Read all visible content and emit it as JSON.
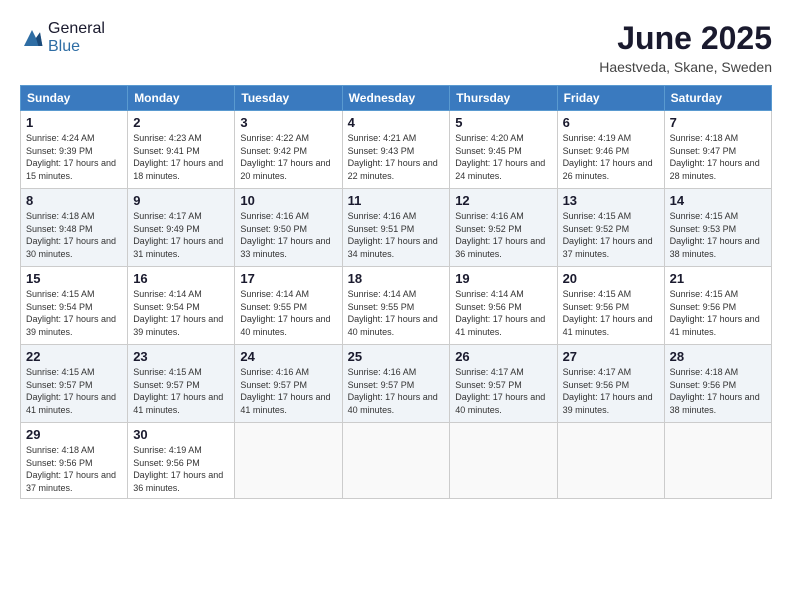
{
  "header": {
    "logo": {
      "line1": "General",
      "line2": "Blue"
    },
    "title": "June 2025",
    "subtitle": "Haestveda, Skane, Sweden"
  },
  "days_of_week": [
    "Sunday",
    "Monday",
    "Tuesday",
    "Wednesday",
    "Thursday",
    "Friday",
    "Saturday"
  ],
  "weeks": [
    [
      {
        "day": "1",
        "rise": "Sunrise: 4:24 AM",
        "set": "Sunset: 9:39 PM",
        "daylight": "Daylight: 17 hours and 15 minutes."
      },
      {
        "day": "2",
        "rise": "Sunrise: 4:23 AM",
        "set": "Sunset: 9:41 PM",
        "daylight": "Daylight: 17 hours and 18 minutes."
      },
      {
        "day": "3",
        "rise": "Sunrise: 4:22 AM",
        "set": "Sunset: 9:42 PM",
        "daylight": "Daylight: 17 hours and 20 minutes."
      },
      {
        "day": "4",
        "rise": "Sunrise: 4:21 AM",
        "set": "Sunset: 9:43 PM",
        "daylight": "Daylight: 17 hours and 22 minutes."
      },
      {
        "day": "5",
        "rise": "Sunrise: 4:20 AM",
        "set": "Sunset: 9:45 PM",
        "daylight": "Daylight: 17 hours and 24 minutes."
      },
      {
        "day": "6",
        "rise": "Sunrise: 4:19 AM",
        "set": "Sunset: 9:46 PM",
        "daylight": "Daylight: 17 hours and 26 minutes."
      },
      {
        "day": "7",
        "rise": "Sunrise: 4:18 AM",
        "set": "Sunset: 9:47 PM",
        "daylight": "Daylight: 17 hours and 28 minutes."
      }
    ],
    [
      {
        "day": "8",
        "rise": "Sunrise: 4:18 AM",
        "set": "Sunset: 9:48 PM",
        "daylight": "Daylight: 17 hours and 30 minutes."
      },
      {
        "day": "9",
        "rise": "Sunrise: 4:17 AM",
        "set": "Sunset: 9:49 PM",
        "daylight": "Daylight: 17 hours and 31 minutes."
      },
      {
        "day": "10",
        "rise": "Sunrise: 4:16 AM",
        "set": "Sunset: 9:50 PM",
        "daylight": "Daylight: 17 hours and 33 minutes."
      },
      {
        "day": "11",
        "rise": "Sunrise: 4:16 AM",
        "set": "Sunset: 9:51 PM",
        "daylight": "Daylight: 17 hours and 34 minutes."
      },
      {
        "day": "12",
        "rise": "Sunrise: 4:16 AM",
        "set": "Sunset: 9:52 PM",
        "daylight": "Daylight: 17 hours and 36 minutes."
      },
      {
        "day": "13",
        "rise": "Sunrise: 4:15 AM",
        "set": "Sunset: 9:52 PM",
        "daylight": "Daylight: 17 hours and 37 minutes."
      },
      {
        "day": "14",
        "rise": "Sunrise: 4:15 AM",
        "set": "Sunset: 9:53 PM",
        "daylight": "Daylight: 17 hours and 38 minutes."
      }
    ],
    [
      {
        "day": "15",
        "rise": "Sunrise: 4:15 AM",
        "set": "Sunset: 9:54 PM",
        "daylight": "Daylight: 17 hours and 39 minutes."
      },
      {
        "day": "16",
        "rise": "Sunrise: 4:14 AM",
        "set": "Sunset: 9:54 PM",
        "daylight": "Daylight: 17 hours and 39 minutes."
      },
      {
        "day": "17",
        "rise": "Sunrise: 4:14 AM",
        "set": "Sunset: 9:55 PM",
        "daylight": "Daylight: 17 hours and 40 minutes."
      },
      {
        "day": "18",
        "rise": "Sunrise: 4:14 AM",
        "set": "Sunset: 9:55 PM",
        "daylight": "Daylight: 17 hours and 40 minutes."
      },
      {
        "day": "19",
        "rise": "Sunrise: 4:14 AM",
        "set": "Sunset: 9:56 PM",
        "daylight": "Daylight: 17 hours and 41 minutes."
      },
      {
        "day": "20",
        "rise": "Sunrise: 4:15 AM",
        "set": "Sunset: 9:56 PM",
        "daylight": "Daylight: 17 hours and 41 minutes."
      },
      {
        "day": "21",
        "rise": "Sunrise: 4:15 AM",
        "set": "Sunset: 9:56 PM",
        "daylight": "Daylight: 17 hours and 41 minutes."
      }
    ],
    [
      {
        "day": "22",
        "rise": "Sunrise: 4:15 AM",
        "set": "Sunset: 9:57 PM",
        "daylight": "Daylight: 17 hours and 41 minutes."
      },
      {
        "day": "23",
        "rise": "Sunrise: 4:15 AM",
        "set": "Sunset: 9:57 PM",
        "daylight": "Daylight: 17 hours and 41 minutes."
      },
      {
        "day": "24",
        "rise": "Sunrise: 4:16 AM",
        "set": "Sunset: 9:57 PM",
        "daylight": "Daylight: 17 hours and 41 minutes."
      },
      {
        "day": "25",
        "rise": "Sunrise: 4:16 AM",
        "set": "Sunset: 9:57 PM",
        "daylight": "Daylight: 17 hours and 40 minutes."
      },
      {
        "day": "26",
        "rise": "Sunrise: 4:17 AM",
        "set": "Sunset: 9:57 PM",
        "daylight": "Daylight: 17 hours and 40 minutes."
      },
      {
        "day": "27",
        "rise": "Sunrise: 4:17 AM",
        "set": "Sunset: 9:56 PM",
        "daylight": "Daylight: 17 hours and 39 minutes."
      },
      {
        "day": "28",
        "rise": "Sunrise: 4:18 AM",
        "set": "Sunset: 9:56 PM",
        "daylight": "Daylight: 17 hours and 38 minutes."
      }
    ],
    [
      {
        "day": "29",
        "rise": "Sunrise: 4:18 AM",
        "set": "Sunset: 9:56 PM",
        "daylight": "Daylight: 17 hours and 37 minutes."
      },
      {
        "day": "30",
        "rise": "Sunrise: 4:19 AM",
        "set": "Sunset: 9:56 PM",
        "daylight": "Daylight: 17 hours and 36 minutes."
      },
      null,
      null,
      null,
      null,
      null
    ]
  ]
}
